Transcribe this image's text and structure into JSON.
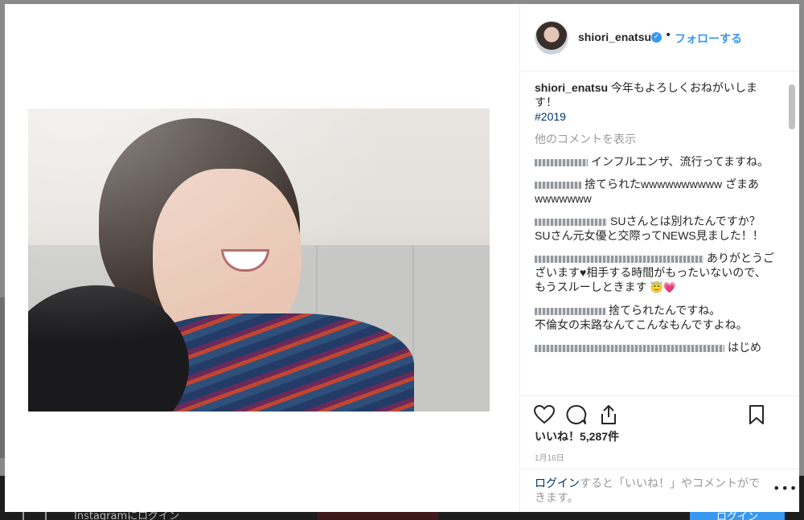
{
  "backdrop": {
    "bar_text": "Instagramにログイン",
    "login_button": "ログイン"
  },
  "header": {
    "username": "shiori_enatsu",
    "separator": "•",
    "follow_label": "フォローする"
  },
  "caption": {
    "username": "shiori_enatsu",
    "text": "今年もよろしくおねがいします！",
    "hashtag": "#2019"
  },
  "view_more_comments": "他のコメントを表示",
  "comments": [
    {
      "text": "インフルエンザ、流行ってますね。"
    },
    {
      "text": "捨てられたwwwwwwwwww ざまあwwwwwww"
    },
    {
      "text": "SUさんとは別れたんですか？",
      "text2": "SUさん元女優と交際ってNEWS見ました！！"
    },
    {
      "text": "ありがとうございます♥相手する時間がもったいないので、もうスルーしときます"
    },
    {
      "text": "捨てられたんですね。",
      "text2": "不倫女の末路なんてこんなもんですよね。"
    },
    {
      "text": "はじめ"
    }
  ],
  "likes": "いいね！5,287件",
  "date": "1月16日",
  "footer": {
    "login_link": "ログイン",
    "text": "すると「いいね！」やコメントができます。",
    "more": "•••"
  },
  "icons": {
    "heart": "heart-icon",
    "comment": "comment-icon",
    "share": "share-icon",
    "bookmark": "bookmark-icon"
  },
  "colors": {
    "accent": "#3897f0",
    "text": "#262626",
    "muted": "#999999",
    "link": "#003569"
  }
}
